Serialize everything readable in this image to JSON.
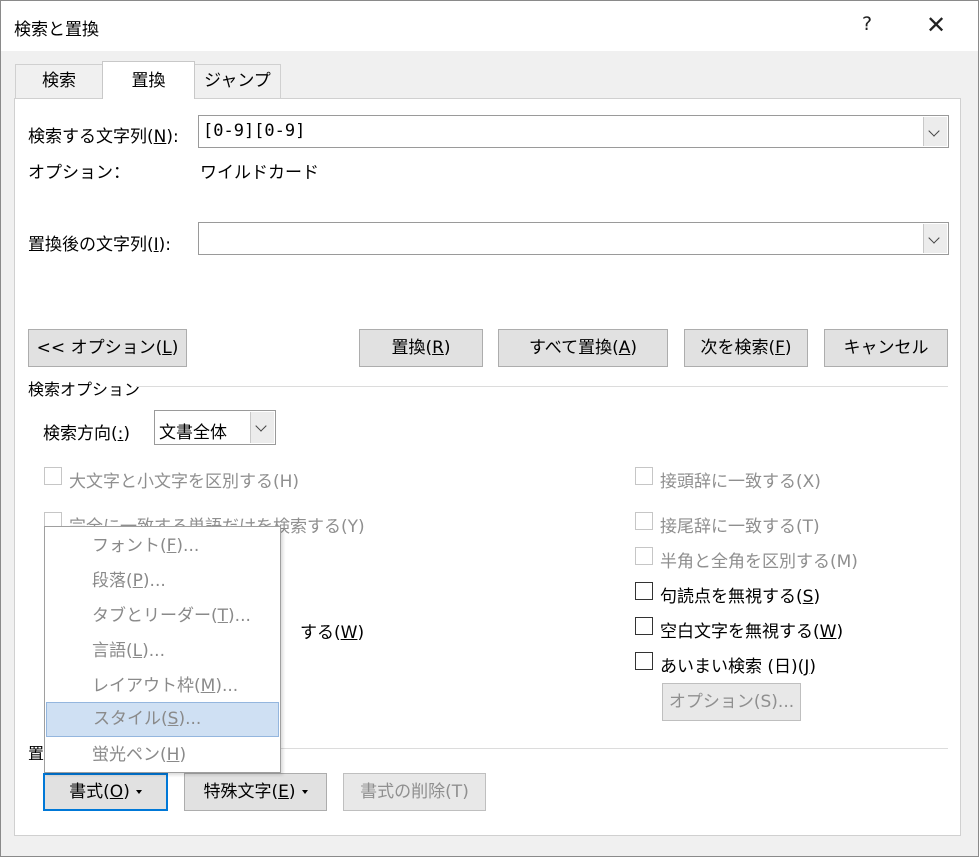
{
  "window": {
    "title": "検索と置換",
    "help": "?",
    "close": "✕"
  },
  "tabs": [
    {
      "label": "検索"
    },
    {
      "label": "置換"
    },
    {
      "label": "ジャンプ"
    }
  ],
  "find": {
    "label_pre": "検索する文字列(",
    "label_key": "N",
    "label_post": "):",
    "value": "[0-9][0-9]"
  },
  "options_line": {
    "label": "オプション：",
    "value": "ワイルドカード"
  },
  "replace": {
    "label_pre": "置換後の文字列(",
    "label_key": "I",
    "label_post": "):",
    "value": ""
  },
  "buttons": {
    "options_pre": "<< オプション(",
    "options_key": "L",
    "options_post": ")",
    "replace_pre": "置換(",
    "replace_key": "R",
    "replace_post": ")",
    "replace_all_pre": "すべて置換(",
    "replace_all_key": "A",
    "replace_all_post": ")",
    "find_next_pre": "次を検索(",
    "find_next_key": "F",
    "find_next_post": ")",
    "cancel": "キャンセル"
  },
  "search_options": {
    "section_title": "検索オプション",
    "direction_label_pre": "検索方向(",
    "direction_label_key": ":",
    "direction_label_post": ")",
    "direction_value": "文書全体",
    "match_case": "大文字と小文字を区別する(H)",
    "whole_word": "完全に一致する単語だけを検索する(Y)",
    "partial_whole": "する(",
    "partial_whole_key": "W",
    "prefix": "接頭辞に一致する(X)",
    "suffix": "接尾辞に一致する(T)",
    "width": "半角と全角を区別する(M)",
    "punct_pre": "句読点を無視する(",
    "punct_key": "S",
    "punct_post": ")",
    "space_pre": "空白文字を無視する(",
    "space_key": "W",
    "space_post": ")",
    "fuzzy_pre": "あいまい検索 (日)(",
    "fuzzy_key": "J",
    "fuzzy_post": ")",
    "fuzzy_options": "オプション(S)..."
  },
  "replace_section": {
    "title_partial": "置"
  },
  "bottom_buttons": {
    "format_pre": "書式(",
    "format_key": "O",
    "format_post": ")",
    "special_pre": "特殊文字(",
    "special_key": "E",
    "special_post": ")",
    "clear_format": "書式の削除(T)"
  },
  "format_menu": [
    {
      "pre": "フォント(",
      "key": "F",
      "post": ")..."
    },
    {
      "pre": "段落(",
      "key": "P",
      "post": ")..."
    },
    {
      "pre": "タブとリーダー(",
      "key": "T",
      "post": ")..."
    },
    {
      "pre": "言語(",
      "key": "L",
      "post": ")..."
    },
    {
      "pre": "レイアウト枠(",
      "key": "M",
      "post": ")..."
    },
    {
      "pre": "スタイル(",
      "key": "S",
      "post": ")..."
    },
    {
      "pre": "蛍光ペン(",
      "key": "H",
      "post": ")"
    }
  ]
}
